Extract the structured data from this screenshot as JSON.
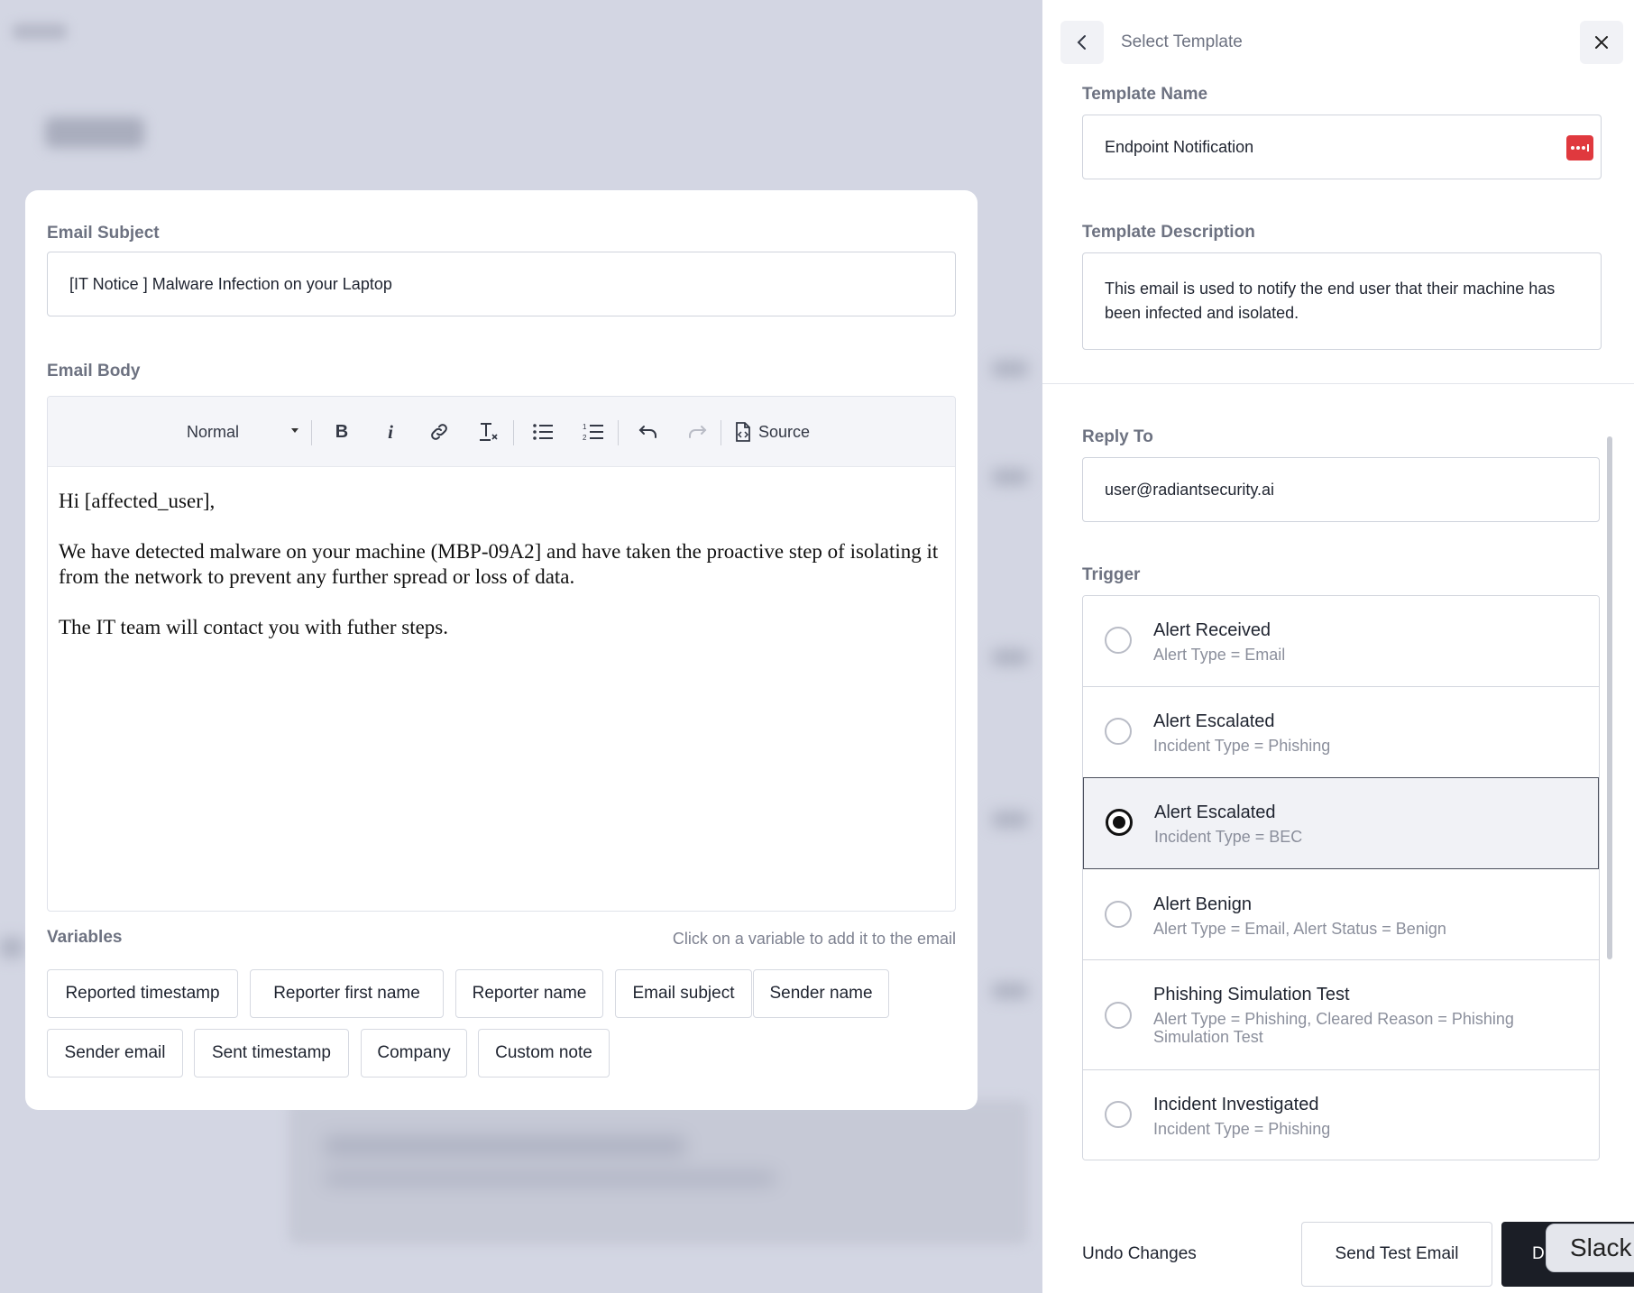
{
  "editor": {
    "subject_label": "Email Subject",
    "subject_value": "[IT Notice ] Malware Infection on your Laptop",
    "body_label": "Email Body",
    "toolbar": {
      "format_value": "Normal",
      "source_label": "Source"
    },
    "body_paragraphs": [
      "Hi [affected_user],",
      "We have detected malware on your machine (MBP-09A2] and have taken the proactive step of isolating it from the network to prevent any further spread or loss of data.",
      "The IT team will contact you with futher steps."
    ],
    "variables_label": "Variables",
    "variables_hint": "Click on a variable to add it to the email",
    "variables": [
      "Reported timestamp",
      "Reporter first name",
      "Reporter name",
      "Email subject",
      "Sender name",
      "Sender email",
      "Sent timestamp",
      "Company",
      "Custom note"
    ]
  },
  "panel": {
    "title": "Select Template",
    "template_name_label": "Template Name",
    "template_name_value": "Endpoint Notification",
    "template_description_label": "Template Description",
    "template_description_value": "This email is used to notify the end user that their machine has been infected and isolated.",
    "reply_to_label": "Reply To",
    "reply_to_value": "user@radiantsecurity.ai",
    "trigger_label": "Trigger",
    "triggers": [
      {
        "title": "Alert Received",
        "subtitle": "Alert Type = Email",
        "selected": false
      },
      {
        "title": "Alert Escalated",
        "subtitle": "Incident Type = Phishing",
        "selected": false
      },
      {
        "title": "Alert Escalated",
        "subtitle": "Incident Type = BEC",
        "selected": true
      },
      {
        "title": "Alert Benign",
        "subtitle": "Alert Type = Email, Alert Status = Benign",
        "selected": false
      },
      {
        "title": "Phishing Simulation Test",
        "subtitle": "Alert Type = Phishing, Cleared Reason = Phishing Simulation Test",
        "selected": false
      },
      {
        "title": "Incident Investigated",
        "subtitle": "Incident Type = Phishing",
        "selected": false
      }
    ],
    "footer": {
      "undo_label": "Undo Changes",
      "send_test_label": "Send Test Email",
      "primary_label_partial": "D"
    },
    "tooltip": "Slack"
  },
  "colors": {
    "accent_dark": "#1b1e26",
    "password_manager_icon": "#e0393e",
    "muted_text": "#6d7281"
  }
}
